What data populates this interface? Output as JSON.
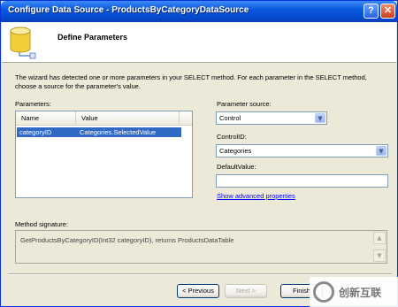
{
  "window": {
    "title": "Configure Data Source - ProductsByCategoryDataSource",
    "help_label": "?",
    "close_label": "✕"
  },
  "header": {
    "title": "Define Parameters",
    "icon": "database-icon"
  },
  "description": "The wizard has detected one or more parameters in your SELECT method. For each parameter in the SELECT method, choose a source for the parameter's value.",
  "parameters": {
    "label": "Parameters:",
    "columns": [
      "Name",
      "Value"
    ],
    "rows": [
      {
        "name": "categoryID",
        "value": "Categories.SelectedValue"
      }
    ]
  },
  "parameter_source": {
    "label": "Parameter source:",
    "value": "Control"
  },
  "control_id": {
    "label": "ControlID:",
    "value": "Categories"
  },
  "default_value": {
    "label": "DefaultValue:",
    "value": ""
  },
  "advanced_link": "Show advanced properties",
  "method_signature": {
    "label": "Method signature:",
    "value": "GetProductsByCategoryID(Int32 categoryID), returns ProductsDataTable"
  },
  "buttons": {
    "previous": "< Previous",
    "next": "Next >",
    "finish": "Finish"
  },
  "watermark": {
    "text": "创新互联"
  },
  "colors": {
    "titlebar": "#0a5ae0",
    "selection": "#316ac5",
    "dialog": "#ece9d8",
    "link": "#0000ff"
  }
}
